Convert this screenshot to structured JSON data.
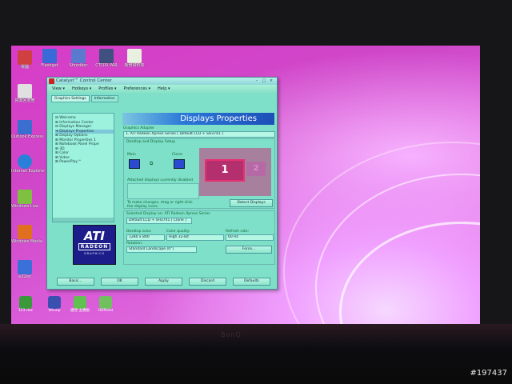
{
  "monitor": {
    "brand": "BenQ"
  },
  "watermark": "#197437",
  "desktop_icons": [
    {
      "label": "電腦",
      "icon": "computer-icon",
      "color": "#d04040"
    },
    {
      "label": "資源回收筒",
      "icon": "recycle-bin-icon",
      "color": "#e0e0e0"
    },
    {
      "label": "Outlook\nExpress",
      "icon": "outlook-express-icon",
      "color": "#3a6fd0"
    },
    {
      "label": "Internet\nExplorer",
      "icon": "internet-explorer-icon",
      "color": "#2a80d8"
    },
    {
      "label": "Windows\nLive",
      "icon": "windows-live-icon",
      "color": "#80c040"
    },
    {
      "label": "Windows\nMedia",
      "icon": "windows-media-icon",
      "color": "#e07020"
    },
    {
      "label": "eZ2ez",
      "icon": "ez2ez-icon",
      "color": "#3a70d8"
    }
  ],
  "top_icons": [
    {
      "label": "Flashget",
      "icon": "flashget-icon",
      "color": "#3a6ad8"
    },
    {
      "label": "Shredder",
      "icon": "shredder-icon",
      "color": "#5a7ad0"
    },
    {
      "label": "CTCPR PAR",
      "icon": "ctcpr-icon",
      "color": "#405080"
    },
    {
      "label": "新增資料夾",
      "icon": "folder-icon",
      "color": "#e8f0e0"
    }
  ],
  "taskbar_icons": [
    {
      "label": "123.doc",
      "icon": "document-icon",
      "color": "#3a9a3a"
    },
    {
      "label": "Winzip",
      "icon": "winzip-icon",
      "color": "#3a50b0"
    },
    {
      "label": "捷徑-主機板",
      "icon": "shortcut-icon",
      "color": "#60c050"
    },
    {
      "label": "HDRtest",
      "icon": "hdr-icon",
      "color": "#70c060"
    }
  ],
  "window": {
    "title": "Catalyst™ Control Center",
    "menu": [
      "View ▾",
      "Hotkeys ▾",
      "Profiles ▾",
      "Preferences ▾",
      "Help ▾"
    ],
    "tabs": [
      "Graphics Settings",
      "Information"
    ],
    "tree": [
      "⊟ Welcome",
      "⊞ Information Center",
      "⊟ Displays Manager",
      "   ➜ Displays Properties",
      "⊞ Display Options",
      "⊞ Monitor Properties 1",
      "⊞ Notebook Panel Prope",
      "⊞ 3D",
      "⊞ Color",
      "⊞ Video",
      "⊞ PowerPlay™"
    ],
    "logo": {
      "brand": "ATI",
      "line2": "RADEON",
      "line3": "GRAPHICS"
    },
    "banner": "Displays Properties",
    "graphics_adapter_label": "Graphics Adapter",
    "graphics_adapter_value": "1. ATI Radeon Xpress Series [ Default LCD + SH3741 ]",
    "desktop_group_label": "Desktop and Display Setup",
    "main_label": "Main",
    "clone_label": "Clone",
    "attached_label": "Attached displays currently disabled",
    "note": "To make changes, drag or right-click the display icons.",
    "detect_button": "Detect Displays",
    "selected_display_label": "Selected Display on: ATI Radeon Xpress Series",
    "selected_display_value": "Default LCD + SH3741  [ Clone ]",
    "desktop_area_label": "Desktop area:",
    "desktop_area_value": "1280 x 800",
    "color_quality_label": "Color quality:",
    "color_quality_value": "High 32-bit",
    "refresh_label": "Refresh rate:",
    "refresh_value": "60 Hz",
    "rotation_label": "Rotation:",
    "rotation_value": "Standard Landscape (0°)",
    "force_button": "Force...",
    "display_1": "1",
    "display_2": "2",
    "bottom_buttons": [
      "Basic...",
      "OK",
      "Apply",
      "Discard",
      "Defaults"
    ]
  }
}
